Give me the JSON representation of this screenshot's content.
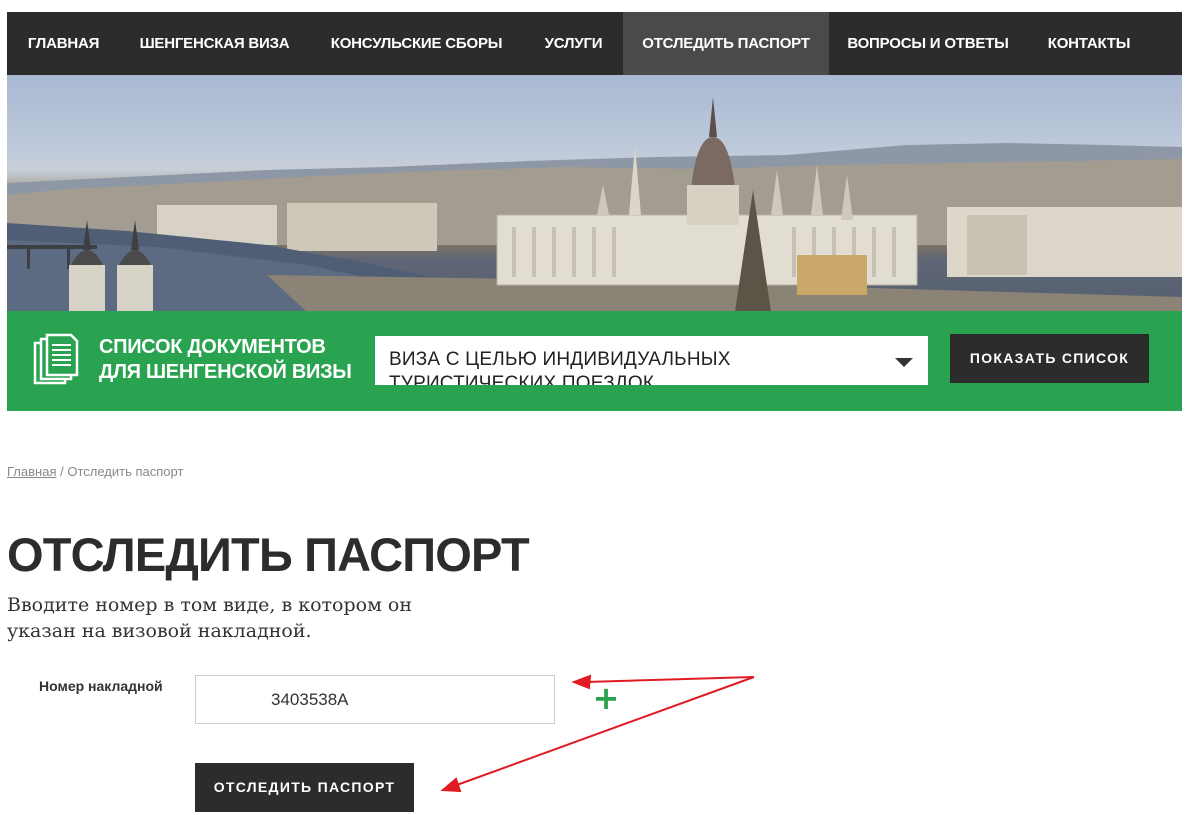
{
  "nav": {
    "items": [
      {
        "label": "ГЛАВНАЯ"
      },
      {
        "label": "ШЕНГЕНСКАЯ ВИЗА"
      },
      {
        "label": "КОНСУЛЬСКИЕ СБОРЫ"
      },
      {
        "label": "УСЛУГИ"
      },
      {
        "label": "ОТСЛЕДИТЬ ПАСПОРТ"
      },
      {
        "label": "ВОПРОСЫ И ОТВЕТЫ"
      },
      {
        "label": "КОНТАКТЫ"
      }
    ],
    "active_index": 4
  },
  "banner": {
    "icon": "city-panorama-image"
  },
  "documents": {
    "icon": "documents-icon",
    "title_line1": "СПИСОК ДОКУМЕНТОВ",
    "title_line2": "ДЛЯ ШЕНГЕНСКОЙ ВИЗЫ",
    "select_value": "ВИЗА С ЦЕЛЬЮ ИНДИВИДУАЛЬНЫХ ТУРИСТИЧЕСКИХ ПОЕЗДОК",
    "button_label": "ПОКАЗАТЬ СПИСОК"
  },
  "breadcrumb": {
    "home": "Главная",
    "separator": " / ",
    "current": "Отследить паспорт"
  },
  "page": {
    "title": "ОТСЛЕДИТЬ ПАСПОРТ",
    "subtitle": "Вводите номер в том виде, в котором он указан на визовой накладной."
  },
  "form": {
    "label": "Номер накладной",
    "value": "3403538A",
    "add_icon": "plus-icon",
    "submit_label": "ОТСЛЕДИТЬ ПАСПОРТ"
  },
  "annotations": {
    "color": "#e01b24"
  },
  "colors": {
    "nav_bg": "#2c2c2c",
    "nav_active": "#4a4a4a",
    "accent_green": "#29a34f",
    "button_dark": "#2c2c2c",
    "plus_green": "#2aa24b"
  }
}
